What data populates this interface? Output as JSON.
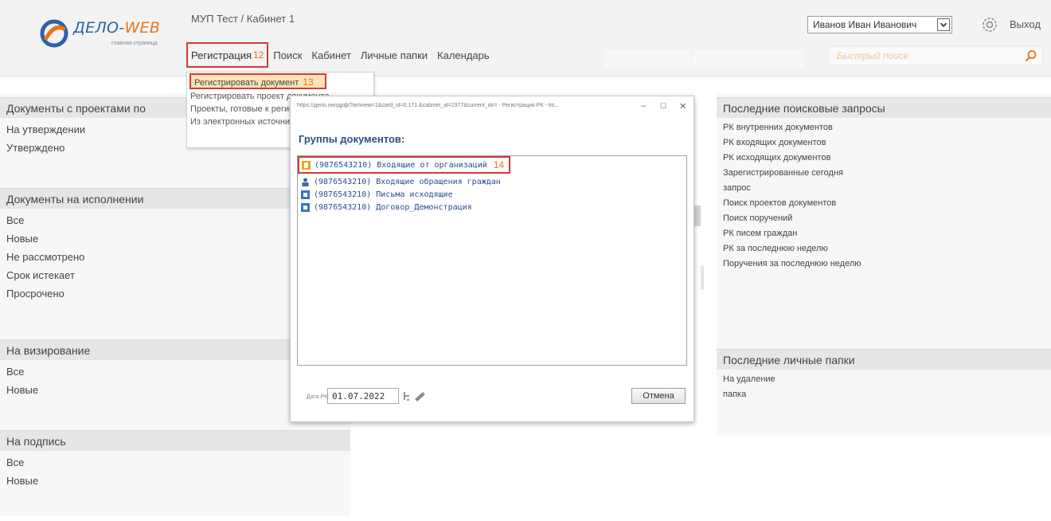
{
  "header": {
    "logo_title_a": "ДЕЛО-",
    "logo_title_b": "WEB",
    "logo_subtitle": "главная страница",
    "window_title": "МУП Тест / Кабинет 1",
    "user_name": "Иванов Иван Иванович",
    "exit_label": "Выход",
    "quick_search_placeholder": "Быстрый поиск"
  },
  "menu": {
    "items": [
      {
        "label": "Регистрация",
        "step": "12"
      },
      {
        "label": "Поиск"
      },
      {
        "label": "Кабинет"
      },
      {
        "label": "Личные папки"
      },
      {
        "label": "Календарь"
      }
    ]
  },
  "dropdown": {
    "items": [
      {
        "label": "Регистрировать документ",
        "step": "13"
      },
      {
        "label": "Регистрировать проект документа"
      },
      {
        "label": "Проекты, готовые к регистрации"
      },
      {
        "label": "Из электронных источников"
      }
    ]
  },
  "left_panels": [
    {
      "title": "Документы с проектами по",
      "rows": [
        "На утверждении",
        "Утверждено"
      ]
    },
    {
      "title": "Документы на исполнении",
      "rows": [
        "Все",
        "Новые",
        "Не рассмотрено",
        "Срок истекает",
        "Просрочено"
      ]
    },
    {
      "title": "На визирование",
      "rows": [
        "Все",
        "Новые"
      ]
    },
    {
      "title": "На подпись",
      "rows": [
        "Все",
        "Новые"
      ]
    }
  ],
  "right_panels": [
    {
      "title": "Последние поисковые запросы",
      "rows": [
        "РК внутренних документов",
        "РК входящих документов",
        "РК исходящих документов",
        "Зарегистрированные сегодня",
        "запрос",
        "Поиск проектов документов",
        "Поиск поручений",
        "РК писем граждан",
        "РК за последнюю неделю",
        "Поручения за последнюю неделю"
      ]
    },
    {
      "title": "Последние личные папки",
      "rows": [
        "На удаление",
        "папка"
      ]
    }
  ],
  "dialog": {
    "url": "https://дело.онлдрф/?amview=1&card_id=0.171.&cabinet_id=2377&current_dir= - Регистрация РК - Int...",
    "heading": "Группы документов:",
    "groups": [
      {
        "label": "(9876543210) Входящие от организаций",
        "step": "14",
        "icon": "incoming-org-icon"
      },
      {
        "label": "(9876543210) Входящие обращения граждан",
        "icon": "citizen-icon"
      },
      {
        "label": "(9876543210) Письма исходящие",
        "icon": "outgoing-icon"
      },
      {
        "label": "(9876543210) Договор_Демонстрация",
        "icon": "contract-icon"
      }
    ],
    "date_label": "Дата РК:",
    "date_value": "01.07.2022",
    "cancel_label": "Отмена"
  },
  "colors": {
    "accent_blue": "#2c62a8",
    "accent_orange": "#e8731b",
    "highlight_red": "#d23a3a"
  }
}
